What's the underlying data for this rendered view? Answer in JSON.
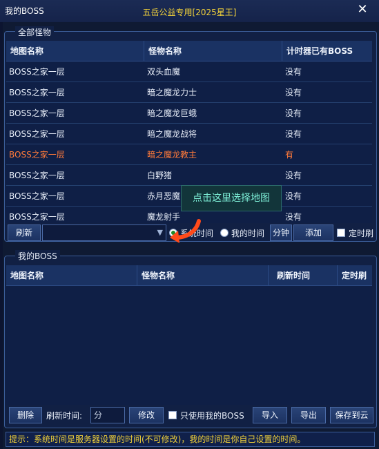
{
  "window": {
    "app_name": "我的BOSS",
    "title": "五岳公益专用[2025星王]",
    "close_glyph": "✕"
  },
  "all_monsters": {
    "legend": "全部怪物",
    "headers": [
      "地图名称",
      "怪物名称",
      "计时器已有BOSS"
    ],
    "rows": [
      {
        "map": "BOSS之家一层",
        "monster": "双头血魔",
        "has": "没有"
      },
      {
        "map": "BOSS之家一层",
        "monster": "暗之魔龙力士",
        "has": "没有"
      },
      {
        "map": "BOSS之家一层",
        "monster": "暗之魔龙巨蛾",
        "has": "没有"
      },
      {
        "map": "BOSS之家一层",
        "monster": "暗之魔龙战将",
        "has": "没有"
      },
      {
        "map": "BOSS之家一层",
        "monster": "暗之魔龙教主",
        "has": "有"
      },
      {
        "map": "BOSS之家一层",
        "monster": "白野猪",
        "has": "没有"
      },
      {
        "map": "BOSS之家一层",
        "monster": "赤月恶魔",
        "has": "没有"
      },
      {
        "map": "BOSS之家一层",
        "monster": "魔龙射手",
        "has": "没有"
      }
    ],
    "highlight_color": "#ff7a3a"
  },
  "controls": {
    "refresh": "刷新",
    "radio_system": "系统时间",
    "radio_mine": "我的时间",
    "minute": "分钟",
    "add": "添加",
    "timed_refresh": "定时刷"
  },
  "tooltip": "点击这里选择地图",
  "my_boss": {
    "legend": "我的BOSS",
    "headers": [
      "地图名称",
      "怪物名称",
      "刷新时间",
      "定时刷"
    ]
  },
  "bottom": {
    "delete": "删除",
    "refresh_time_label": "刷新时间:",
    "minute_placeholder": "分",
    "modify": "修改",
    "only_mine": "只使用我的BOSS",
    "import": "导入",
    "export": "导出",
    "save_cloud": "保存到云"
  },
  "status": "提示：系统时间是服务器设置的时间(不可修改)，我的时间是你自己设置的时间。"
}
